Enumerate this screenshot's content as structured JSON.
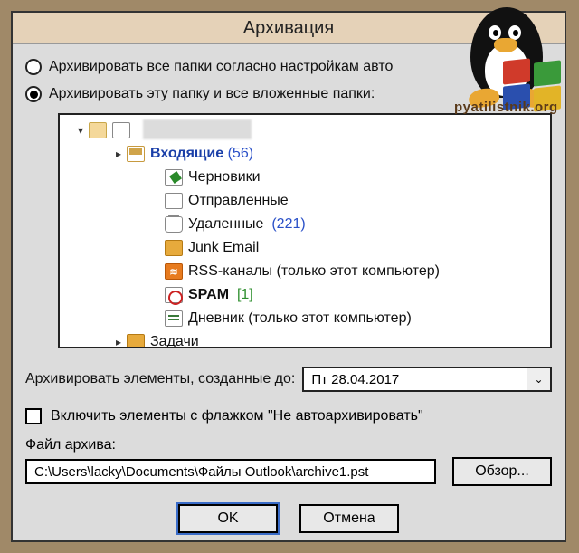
{
  "dialog": {
    "title": "Архивация",
    "radio_all": "Архивировать все папки согласно настройкам авто",
    "radio_this": "Архивировать эту папку и все вложенные папки:",
    "selected_radio": "this"
  },
  "tree": {
    "root_redacted": "",
    "items": [
      {
        "key": "inbox",
        "label": "Входящие",
        "count": "(56)",
        "count_style": "blue",
        "selected": true,
        "has_children": true
      },
      {
        "key": "drafts",
        "label": "Черновики",
        "count": "",
        "selected": false
      },
      {
        "key": "sent",
        "label": "Отправленные",
        "count": "",
        "selected": false
      },
      {
        "key": "trash",
        "label": "Удаленные",
        "count": "(221)",
        "count_style": "blue",
        "selected": false
      },
      {
        "key": "junk",
        "label": "Junk Email",
        "count": "",
        "selected": false
      },
      {
        "key": "rss",
        "label": "RSS-каналы (только этот компьютер)",
        "count": "",
        "selected": false
      },
      {
        "key": "spam",
        "label": "SPAM",
        "count": "[1]",
        "count_style": "green",
        "selected": false
      },
      {
        "key": "journal",
        "label": "Дневник (только этот компьютер)",
        "count": "",
        "selected": false
      },
      {
        "key": "tasks",
        "label": "Задачи",
        "count": "",
        "selected": false,
        "has_children": true
      }
    ]
  },
  "date": {
    "label": "Архивировать элементы, созданные до:",
    "value": "Пт 28.04.2017"
  },
  "checkbox": {
    "label": "Включить элементы с флажком \"Не автоархивировать\"",
    "checked": false
  },
  "file": {
    "label": "Файл архива:",
    "path": "C:\\Users\\lacky\\Documents\\Файлы Outlook\\archive1.pst",
    "browse": "Обзор..."
  },
  "buttons": {
    "ok": "OK",
    "cancel": "Отмена"
  },
  "watermark": {
    "text": "pyatilistnik.org"
  }
}
